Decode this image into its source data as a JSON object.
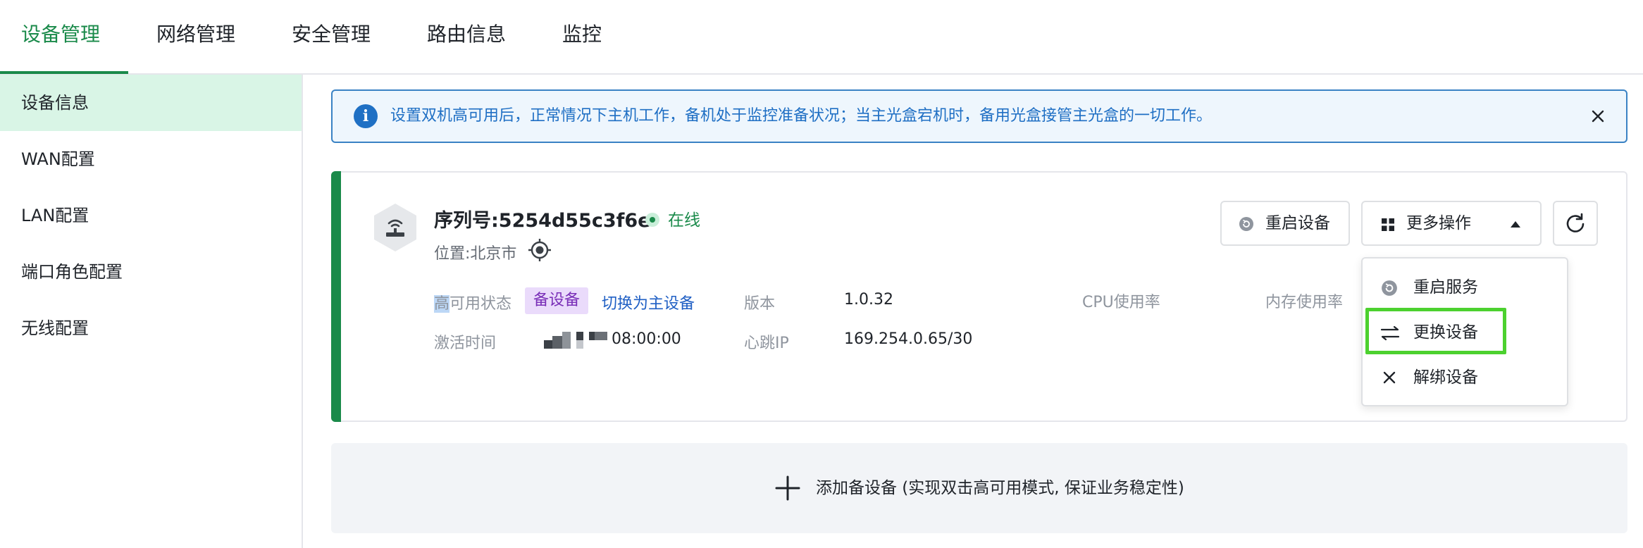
{
  "tabs": [
    {
      "label": "设备管理"
    },
    {
      "label": "网络管理"
    },
    {
      "label": "安全管理"
    },
    {
      "label": "路由信息"
    },
    {
      "label": "监控"
    }
  ],
  "sidebar": {
    "items": [
      {
        "label": "设备信息"
      },
      {
        "label": "WAN配置"
      },
      {
        "label": "LAN配置"
      },
      {
        "label": "端口角色配置"
      },
      {
        "label": "无线配置"
      }
    ]
  },
  "alert": {
    "text": "设置双机高可用后，正常情况下主机工作，备机处于监控准备状况；当主光盒宕机时，备用光盒接管主光盒的一切工作。"
  },
  "device": {
    "serial": "序列号:5254d55c3f6e",
    "status": "在线",
    "location": "位置:北京市",
    "ha_state_label_first": "高",
    "ha_state_label_rest": "可用状态",
    "role_badge": "备设备",
    "switch_link": "切换为主设备",
    "version_label": "版本",
    "version_value": "1.0.32",
    "cpu_label": "CPU使用率",
    "mem_label": "内存使用率",
    "activation_label": "激活时间",
    "activation_time": "08:00:00",
    "heartbeat_label": "心跳IP",
    "heartbeat_value": "169.254.0.65/30"
  },
  "actions": {
    "restart": "重启设备",
    "more": "更多操作"
  },
  "dropdown": {
    "items": [
      {
        "label": "重启服务",
        "icon": "restart-service-icon"
      },
      {
        "label": "更换设备",
        "icon": "swap-icon"
      },
      {
        "label": "解绑设备",
        "icon": "close-icon"
      }
    ]
  },
  "add_standby": {
    "label": "添加备设备  (实现双击高可用模式, 保证业务稳定性)"
  },
  "colors": {
    "accent": "#1a8a4a",
    "active_bg": "#d9f5e6",
    "info": "#1f6fc4",
    "badge_bg": "#eadbfb",
    "badge_text": "#7a2fb8",
    "highlight": "#4cd12f"
  }
}
